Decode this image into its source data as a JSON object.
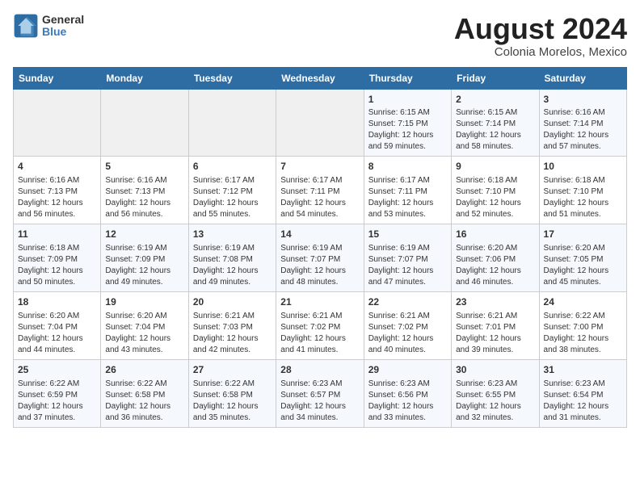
{
  "header": {
    "logo": {
      "line1": "General",
      "line2": "Blue"
    },
    "title": "August 2024",
    "location": "Colonia Morelos, Mexico"
  },
  "weekdays": [
    "Sunday",
    "Monday",
    "Tuesday",
    "Wednesday",
    "Thursday",
    "Friday",
    "Saturday"
  ],
  "weeks": [
    [
      {
        "day": "",
        "info": ""
      },
      {
        "day": "",
        "info": ""
      },
      {
        "day": "",
        "info": ""
      },
      {
        "day": "",
        "info": ""
      },
      {
        "day": "1",
        "info": "Sunrise: 6:15 AM\nSunset: 7:15 PM\nDaylight: 12 hours\nand 59 minutes."
      },
      {
        "day": "2",
        "info": "Sunrise: 6:15 AM\nSunset: 7:14 PM\nDaylight: 12 hours\nand 58 minutes."
      },
      {
        "day": "3",
        "info": "Sunrise: 6:16 AM\nSunset: 7:14 PM\nDaylight: 12 hours\nand 57 minutes."
      }
    ],
    [
      {
        "day": "4",
        "info": "Sunrise: 6:16 AM\nSunset: 7:13 PM\nDaylight: 12 hours\nand 56 minutes."
      },
      {
        "day": "5",
        "info": "Sunrise: 6:16 AM\nSunset: 7:13 PM\nDaylight: 12 hours\nand 56 minutes."
      },
      {
        "day": "6",
        "info": "Sunrise: 6:17 AM\nSunset: 7:12 PM\nDaylight: 12 hours\nand 55 minutes."
      },
      {
        "day": "7",
        "info": "Sunrise: 6:17 AM\nSunset: 7:11 PM\nDaylight: 12 hours\nand 54 minutes."
      },
      {
        "day": "8",
        "info": "Sunrise: 6:17 AM\nSunset: 7:11 PM\nDaylight: 12 hours\nand 53 minutes."
      },
      {
        "day": "9",
        "info": "Sunrise: 6:18 AM\nSunset: 7:10 PM\nDaylight: 12 hours\nand 52 minutes."
      },
      {
        "day": "10",
        "info": "Sunrise: 6:18 AM\nSunset: 7:10 PM\nDaylight: 12 hours\nand 51 minutes."
      }
    ],
    [
      {
        "day": "11",
        "info": "Sunrise: 6:18 AM\nSunset: 7:09 PM\nDaylight: 12 hours\nand 50 minutes."
      },
      {
        "day": "12",
        "info": "Sunrise: 6:19 AM\nSunset: 7:09 PM\nDaylight: 12 hours\nand 49 minutes."
      },
      {
        "day": "13",
        "info": "Sunrise: 6:19 AM\nSunset: 7:08 PM\nDaylight: 12 hours\nand 49 minutes."
      },
      {
        "day": "14",
        "info": "Sunrise: 6:19 AM\nSunset: 7:07 PM\nDaylight: 12 hours\nand 48 minutes."
      },
      {
        "day": "15",
        "info": "Sunrise: 6:19 AM\nSunset: 7:07 PM\nDaylight: 12 hours\nand 47 minutes."
      },
      {
        "day": "16",
        "info": "Sunrise: 6:20 AM\nSunset: 7:06 PM\nDaylight: 12 hours\nand 46 minutes."
      },
      {
        "day": "17",
        "info": "Sunrise: 6:20 AM\nSunset: 7:05 PM\nDaylight: 12 hours\nand 45 minutes."
      }
    ],
    [
      {
        "day": "18",
        "info": "Sunrise: 6:20 AM\nSunset: 7:04 PM\nDaylight: 12 hours\nand 44 minutes."
      },
      {
        "day": "19",
        "info": "Sunrise: 6:20 AM\nSunset: 7:04 PM\nDaylight: 12 hours\nand 43 minutes."
      },
      {
        "day": "20",
        "info": "Sunrise: 6:21 AM\nSunset: 7:03 PM\nDaylight: 12 hours\nand 42 minutes."
      },
      {
        "day": "21",
        "info": "Sunrise: 6:21 AM\nSunset: 7:02 PM\nDaylight: 12 hours\nand 41 minutes."
      },
      {
        "day": "22",
        "info": "Sunrise: 6:21 AM\nSunset: 7:02 PM\nDaylight: 12 hours\nand 40 minutes."
      },
      {
        "day": "23",
        "info": "Sunrise: 6:21 AM\nSunset: 7:01 PM\nDaylight: 12 hours\nand 39 minutes."
      },
      {
        "day": "24",
        "info": "Sunrise: 6:22 AM\nSunset: 7:00 PM\nDaylight: 12 hours\nand 38 minutes."
      }
    ],
    [
      {
        "day": "25",
        "info": "Sunrise: 6:22 AM\nSunset: 6:59 PM\nDaylight: 12 hours\nand 37 minutes."
      },
      {
        "day": "26",
        "info": "Sunrise: 6:22 AM\nSunset: 6:58 PM\nDaylight: 12 hours\nand 36 minutes."
      },
      {
        "day": "27",
        "info": "Sunrise: 6:22 AM\nSunset: 6:58 PM\nDaylight: 12 hours\nand 35 minutes."
      },
      {
        "day": "28",
        "info": "Sunrise: 6:23 AM\nSunset: 6:57 PM\nDaylight: 12 hours\nand 34 minutes."
      },
      {
        "day": "29",
        "info": "Sunrise: 6:23 AM\nSunset: 6:56 PM\nDaylight: 12 hours\nand 33 minutes."
      },
      {
        "day": "30",
        "info": "Sunrise: 6:23 AM\nSunset: 6:55 PM\nDaylight: 12 hours\nand 32 minutes."
      },
      {
        "day": "31",
        "info": "Sunrise: 6:23 AM\nSunset: 6:54 PM\nDaylight: 12 hours\nand 31 minutes."
      }
    ]
  ]
}
